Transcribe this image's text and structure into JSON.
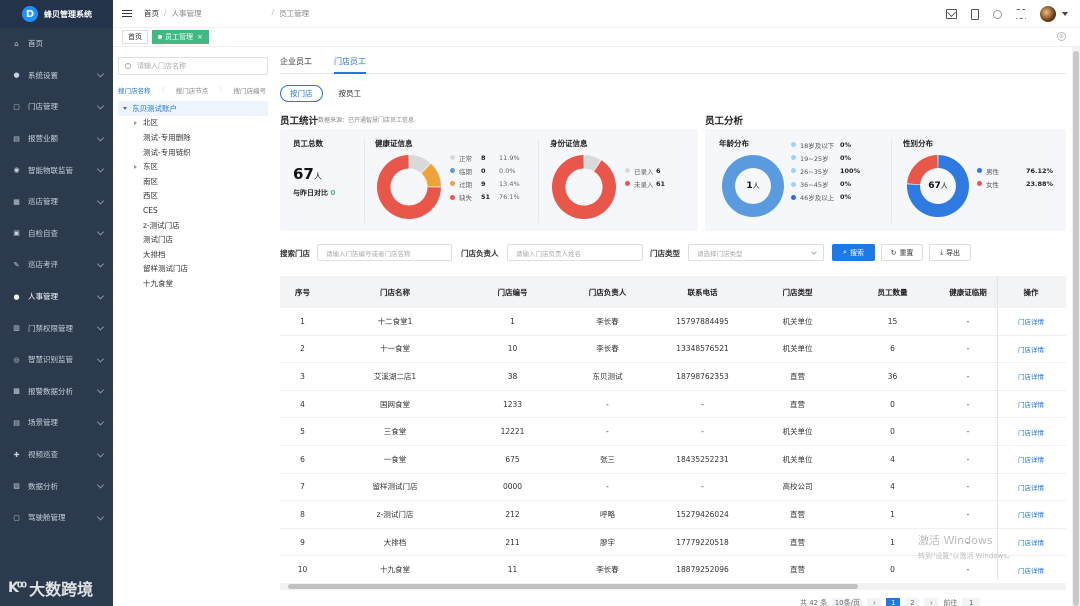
{
  "app": {
    "title": "蜂贝管理系统",
    "logo_letter": "D"
  },
  "sidebar": {
    "items": [
      {
        "label": "首页",
        "icon": "home-icon",
        "glyph": "⌂",
        "arrow": false
      },
      {
        "label": "系统设置",
        "icon": "user-icon",
        "glyph": "●",
        "arrow": true
      },
      {
        "label": "门店管理",
        "icon": "store-icon",
        "glyph": "▢",
        "arrow": true
      },
      {
        "label": "报营业额",
        "icon": "report-icon",
        "glyph": "▤",
        "arrow": true
      },
      {
        "label": "智能物联监管",
        "icon": "iot-icon",
        "glyph": "◉",
        "arrow": true
      },
      {
        "label": "巡店管理",
        "icon": "inspect-icon",
        "glyph": "▦",
        "arrow": true
      },
      {
        "label": "自检自查",
        "icon": "selfcheck-icon",
        "glyph": "▣",
        "arrow": true
      },
      {
        "label": "巡店考评",
        "icon": "evaluate-icon",
        "glyph": "✎",
        "arrow": true
      },
      {
        "label": "人事管理",
        "icon": "personnel-icon",
        "glyph": "●",
        "arrow": true,
        "active": true
      },
      {
        "label": "门禁权限管理",
        "icon": "access-icon",
        "glyph": "▥",
        "arrow": true
      },
      {
        "label": "智慧识别监管",
        "icon": "recognition-icon",
        "glyph": "◎",
        "arrow": true
      },
      {
        "label": "报警数据分析",
        "icon": "alarm-icon",
        "glyph": "▩",
        "arrow": true
      },
      {
        "label": "场景管理",
        "icon": "scene-icon",
        "glyph": "▤",
        "arrow": true
      },
      {
        "label": "视频巡查",
        "icon": "video-icon",
        "glyph": "✚",
        "arrow": true
      },
      {
        "label": "数据分析",
        "icon": "analysis-icon",
        "glyph": "▨",
        "arrow": true
      },
      {
        "label": "驾驶舱管理",
        "icon": "cockpit-icon",
        "glyph": "▢",
        "arrow": true
      }
    ],
    "watermark": "大数跨境",
    "watermark_mark": "K⁰⁰"
  },
  "header": {
    "breadcrumb": [
      "首页",
      "人事管理",
      "员工管理"
    ],
    "sep": "/"
  },
  "tags": {
    "home": "首页",
    "current": "员工管理",
    "close": "×",
    "close_all": "⊗"
  },
  "tree": {
    "search_placeholder": "请输入门店名称",
    "tabs": [
      "搜门店名称",
      "搜门店节点",
      "搜门店编号"
    ],
    "tab_sep": "|",
    "root": "东贝测试账户",
    "nodes": [
      {
        "label": "北区",
        "expandable": true
      },
      {
        "label": "测试-专用删除",
        "expandable": false
      },
      {
        "label": "测试-专用链织",
        "expandable": false
      },
      {
        "label": "东区",
        "expandable": true
      },
      {
        "label": "南区",
        "expandable": false
      },
      {
        "label": "西区",
        "expandable": false
      },
      {
        "label": "CES",
        "expandable": false
      },
      {
        "label": "z-测试门店",
        "expandable": false
      },
      {
        "label": "测试门店",
        "expandable": false
      },
      {
        "label": "大排档",
        "expandable": false
      },
      {
        "label": "留样测试门店",
        "expandable": false
      },
      {
        "label": "十九食堂",
        "expandable": false
      }
    ]
  },
  "main": {
    "tabs": [
      "企业员工",
      "门店员工"
    ],
    "subtabs": [
      "按门店",
      "按员工"
    ],
    "stats_title": "员工统计",
    "stats_note": "数据来源：已开通智慧门店员工信息",
    "analysis_title": "员工分析",
    "total": {
      "label": "员工总数",
      "value": "67",
      "unit": "人",
      "compare_label": "与昨日对比",
      "compare_value": "0"
    },
    "health": {
      "title": "健康证信息",
      "legend": [
        {
          "name": "正常",
          "count": "8",
          "pct": "11.9%",
          "color": "#d9d9d9"
        },
        {
          "name": "临期",
          "count": "0",
          "pct": "0.0%",
          "color": "#5b9bd5"
        },
        {
          "name": "过期",
          "count": "9",
          "pct": "13.4%",
          "color": "#f0a23a"
        },
        {
          "name": "缺失",
          "count": "51",
          "pct": "76.1%",
          "color": "#e8574a"
        }
      ],
      "slices": [
        11.9,
        0.0,
        13.4,
        76.1
      ]
    },
    "idcard": {
      "title": "身份证信息",
      "legend": [
        {
          "name": "已录入",
          "count": "6",
          "color": "#d9d9d9"
        },
        {
          "name": "未录入",
          "count": "61",
          "color": "#e8574a"
        }
      ],
      "slices": [
        6,
        61
      ]
    },
    "age": {
      "title": "年龄分布",
      "center": "1",
      "center_unit": "人",
      "legend": [
        {
          "name": "18岁及以下",
          "pct": "0%",
          "color": "#a6cdf5"
        },
        {
          "name": "19~25岁",
          "pct": "0%",
          "color": "#a6cdf5"
        },
        {
          "name": "26~35岁",
          "pct": "100%",
          "color": "#a6cdf5"
        },
        {
          "name": "36~45岁",
          "pct": "0%",
          "color": "#a6cdf5"
        },
        {
          "name": "46岁及以上",
          "pct": "0%",
          "color": "#2f6fd0"
        }
      ]
    },
    "gender": {
      "title": "性别分布",
      "center": "67",
      "center_unit": "人",
      "legend": [
        {
          "name": "男性",
          "pct": "76.12%",
          "color": "#2f7ae0"
        },
        {
          "name": "女性",
          "pct": "23.88%",
          "color": "#e8574a"
        }
      ],
      "slices": [
        76.12,
        23.88
      ]
    }
  },
  "search": {
    "store_label": "搜索门店",
    "store_placeholder": "请输入门店编号或者门店名称",
    "manager_label": "门店负责人",
    "manager_placeholder": "请输入门店负责人姓名",
    "type_label": "门店类型",
    "type_placeholder": "请选择门店类型",
    "search_btn": "搜索",
    "reset_btn": "重置",
    "export_btn": "导出"
  },
  "table": {
    "headers": [
      "序号",
      "门店名称",
      "门店编号",
      "门店负责人",
      "联系电话",
      "门店类型",
      "员工数量",
      "健康证临期",
      "操作"
    ],
    "action_label": "门店详情",
    "rows": [
      [
        "1",
        "十二食堂1",
        "1",
        "李长春",
        "15797884495",
        "机关单位",
        "15",
        "-"
      ],
      [
        "2",
        "十一食堂",
        "10",
        "李长春",
        "13348576521",
        "机关单位",
        "6",
        "-"
      ],
      [
        "3",
        "艾溪湖二店1",
        "38",
        "东贝测试",
        "18798762353",
        "直营",
        "36",
        "-"
      ],
      [
        "4",
        "国网食堂",
        "1233",
        "-",
        "-",
        "直营",
        "0",
        "-"
      ],
      [
        "5",
        "三食堂",
        "12221",
        "-",
        "-",
        "机关单位",
        "0",
        "-"
      ],
      [
        "6",
        "一食堂",
        "675",
        "张三",
        "18435252231",
        "机关单位",
        "4",
        "-"
      ],
      [
        "7",
        "留样测试门店",
        "0000",
        "-",
        "-",
        "高校公司",
        "4",
        "-"
      ],
      [
        "8",
        "z-测试门店",
        "212",
        "呼略",
        "15279426024",
        "直营",
        "1",
        "-"
      ],
      [
        "9",
        "大排档",
        "211",
        "廖宇",
        "17779220518",
        "直营",
        "1",
        "-"
      ],
      [
        "10",
        "十九食堂",
        "11",
        "李长春",
        "18879252096",
        "直营",
        "0",
        "-"
      ]
    ]
  },
  "pager": {
    "total": "共 42 条",
    "size": "10条/页",
    "prev": "‹",
    "p1": "1",
    "p2": "2",
    "next": "›",
    "goto": "前往",
    "page": "1"
  },
  "windows_watermark": {
    "line1": "激活 Windows",
    "line2": "转到\"设置\"以激活 Windows。"
  }
}
